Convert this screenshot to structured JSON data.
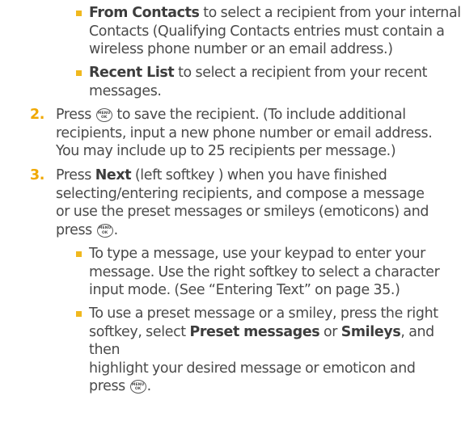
{
  "menu_ok_icon": {
    "top": "MENU",
    "bottom": "OK"
  },
  "bullets_top": [
    {
      "bold": "From Contacts",
      "lines": [
        " to select a recipient from your internal",
        "Contacts (Qualifying Contacts entries must contain a",
        "wireless phone number or an email address.)"
      ]
    },
    {
      "bold": "Recent List",
      "lines": [
        " to select a recipient from your recent",
        "messages."
      ]
    }
  ],
  "step2": {
    "number": "2.",
    "pre_icon": "Press ",
    "line1_post": " to save the recipient. (To include additional",
    "lines": [
      "recipients, input a new phone number or email address.",
      "You may include up to 25 recipients per message.)"
    ]
  },
  "step3": {
    "number": "3.",
    "pre": "Press ",
    "bold": "Next",
    "line1_post": " (left softkey ) when you have finished",
    "lines": [
      "selecting/entering recipients, and compose a message",
      "or use the preset messages or smileys (emoticons) and"
    ],
    "last_pre": "press ",
    "last_post": "."
  },
  "bullets_bottom": [
    {
      "lines": [
        "To type a message, use your keypad to enter your",
        "message. Use the right softkey to select a character",
        "input mode. (See “Entering Text” on page 35.)"
      ]
    },
    {
      "line1": "To use a preset  message or a smiley, press the right",
      "line2_pre": "softkey, select ",
      "line2_bold1": "Preset messages",
      "line2_mid": " or ",
      "line2_bold2": "Smileys",
      "line2_post": ", and then",
      "line3": "highlight your desired message or emoticon and",
      "line4_pre": "press ",
      "line4_post": "."
    }
  ]
}
